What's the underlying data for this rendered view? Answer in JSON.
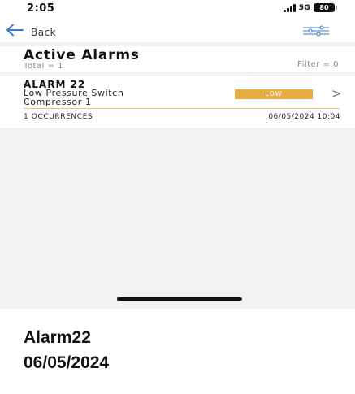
{
  "status_bar": {
    "time": "2:05",
    "network": "5G",
    "battery": "80"
  },
  "nav": {
    "back_label": "Back",
    "icons": {
      "back": "back-arrow-icon",
      "filter": "filter-sliders-icon"
    }
  },
  "header": {
    "title": "Active Alarms",
    "total": "Total = 1",
    "filter": "Filter = 0"
  },
  "alarms": [
    {
      "name": "ALARM 22",
      "line1": "Low Pressure Switch",
      "line2": "Compressor 1",
      "severity": "LOW",
      "occurrences": "1 OCCURRENCES",
      "timestamp": "06/05/2024 10:04"
    }
  ],
  "caption": {
    "line1": "Alarm22",
    "line2": "06/05/2024"
  },
  "colors": {
    "accent": "#3a78d8",
    "severity_low": "#e7ad40",
    "divider": "#e5c86a",
    "background": "#f2f2f2"
  }
}
